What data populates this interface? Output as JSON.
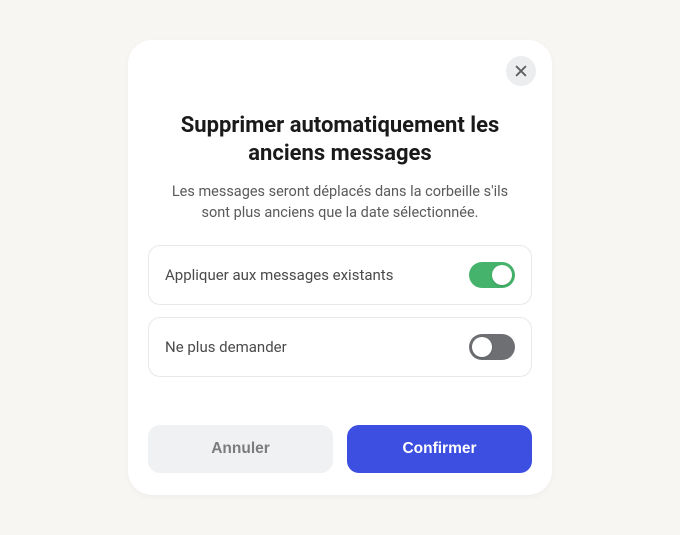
{
  "modal": {
    "title": "Supprimer automatiquement les anciens messages",
    "subtitle": "Les messages seront déplacés dans la corbeille s'ils sont plus anciens que la date sélectionnée.",
    "options": {
      "apply_existing": {
        "label": "Appliquer aux messages existants",
        "on": true,
        "on_color": "#45b36b",
        "off_color": "#6d6f72"
      },
      "dont_ask": {
        "label": "Ne plus demander",
        "on": false,
        "on_color": "#45b36b",
        "off_color": "#6d6f72"
      }
    },
    "actions": {
      "cancel_label": "Annuler",
      "confirm_label": "Confirmer"
    },
    "close_icon": "close-icon"
  },
  "colors": {
    "accent": "#3c4fe0",
    "toggle_on": "#45b36b",
    "toggle_off": "#6d6f72",
    "page_bg": "#f8f6f2",
    "modal_bg": "#ffffff"
  }
}
